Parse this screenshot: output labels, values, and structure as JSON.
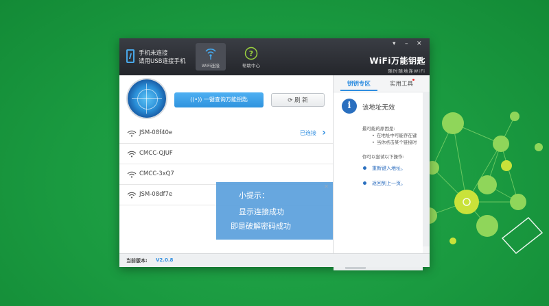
{
  "header": {
    "phone_status_line1": "手机未连接",
    "phone_status_line2": "请用USB连接手机",
    "tabs": [
      {
        "label": "WiFi连接",
        "active": true
      },
      {
        "label": "帮助中心",
        "active": false
      }
    ],
    "brand_title": "WiFi万能钥匙",
    "brand_slogan": "随时随地连WiFi",
    "window_controls": {
      "menu": "▾",
      "minimize": "–",
      "close": "✕"
    }
  },
  "actions": {
    "query_button": "一键查询万能钥匙",
    "refresh_button": "刷 新"
  },
  "networks": [
    {
      "ssid": "JSM-08f40e",
      "status": "已连接"
    },
    {
      "ssid": "CMCC-QJUF",
      "status": ""
    },
    {
      "ssid": "CMCC-3xQ7",
      "status": ""
    },
    {
      "ssid": "JSM-08df7e",
      "status": ""
    }
  ],
  "tip": {
    "title": "小提示：",
    "line1": "显示连接成功",
    "line2": "即是破解密码成功"
  },
  "right_panel": {
    "tabs": [
      "钥钥专区",
      "实用工具"
    ],
    "info_title": "该地址无效",
    "reasons_header": "最可能的原因是:",
    "reasons": [
      "在地址中可能存在键",
      "当你点击某个链接时"
    ],
    "try_header": "你可以尝试以下操作:",
    "actions": [
      "重新键入地址。",
      "返回到上一页。"
    ]
  },
  "statusbar": {
    "version_label": "当前版本:",
    "version_value": "V2.0.8"
  },
  "colors": {
    "accent": "#2f8ee0",
    "background_green": "#1a9a40",
    "titlebar": "#2b2d33"
  }
}
